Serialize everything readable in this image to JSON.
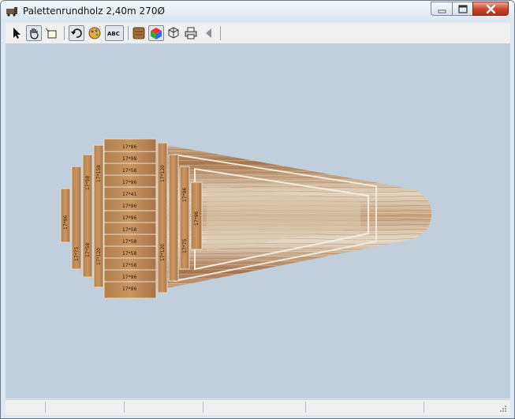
{
  "window": {
    "title": "Palettenrundholz 2,40m 270Ø",
    "accent": "#c8452c",
    "viewport_bg": "#c1cedc"
  },
  "titlebar_controls": [
    "minimize-icon",
    "maximize-icon",
    "close-icon"
  ],
  "toolbar": {
    "tools": [
      {
        "name": "select-arrow-icon",
        "pressed": false
      },
      {
        "name": "hand-pan-icon",
        "pressed": true
      },
      {
        "name": "crop-icon",
        "pressed": false
      },
      {
        "name": "undo-rotate-icon",
        "pressed": true
      },
      {
        "name": "paint-icon",
        "pressed": false
      },
      {
        "name": "abc-label-icon",
        "pressed": true
      },
      {
        "name": "wood-texture-icon",
        "pressed": false
      },
      {
        "name": "color-cube-icon",
        "pressed": true
      },
      {
        "name": "wireframe-cube-icon",
        "pressed": false
      },
      {
        "name": "printer-icon",
        "pressed": false
      },
      {
        "name": "back-triangle-icon",
        "pressed": false
      }
    ],
    "abc_text": "ABC"
  },
  "log_3d": {
    "cross_section_labels": {
      "left_column": [
        "17*96",
        "17*75"
      ],
      "column_2": [
        "17*58",
        "17*58"
      ],
      "column_3": [
        "17*158",
        "17*96",
        "17*120",
        "17*58"
      ],
      "center_column": [
        "17*86",
        "17*98",
        "17*58",
        "17*96",
        "17*41",
        "17*96",
        "17*96",
        "17*58",
        "17*58",
        "17*58",
        "17*58",
        "17*96",
        "17*96"
      ],
      "column_5": [
        "17*120",
        "17*120"
      ],
      "column_6": [
        "17*96",
        "17*75"
      ],
      "column_7": [
        "17*96"
      ]
    }
  },
  "statusbar": {
    "cells": [
      "",
      "",
      "",
      "",
      "",
      ""
    ]
  }
}
